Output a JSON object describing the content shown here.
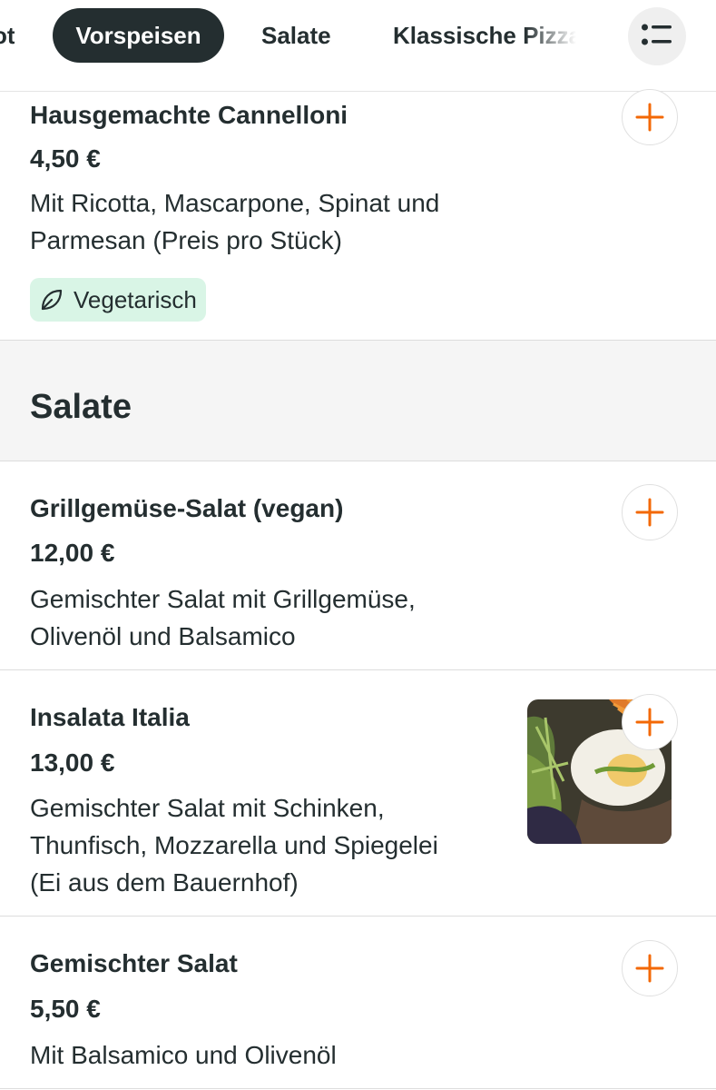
{
  "nav": {
    "tabs": [
      {
        "label": "ot"
      },
      {
        "label": "Vorspeisen"
      },
      {
        "label": "Salate"
      },
      {
        "label": "Klassische Pizza"
      }
    ],
    "menu_icon": "list-icon"
  },
  "items": [
    {
      "name": "Hausgemachte Cannelloni",
      "price": "4,50 €",
      "desc_lines": [
        "Mit Ricotta, Mascarpone, Spinat und",
        "Parmesan (Preis pro Stück)"
      ],
      "badge": "Vegetarisch"
    },
    {
      "name": "Grillgemüse-Salat (vegan)",
      "price": "12,00 €",
      "desc_lines": [
        "Gemischter Salat mit Grillgemüse,",
        "Olivenöl und Balsamico"
      ]
    },
    {
      "name": "Insalata Italia",
      "price": "13,00 €",
      "desc_lines": [
        "Gemischter Salat mit Schinken,",
        "Thunfisch, Mozzarella und Spiegelei",
        "(Ei aus dem Bauernhof)"
      ]
    },
    {
      "name": "Gemischter Salat",
      "price": "5,50 €",
      "desc_lines": [
        "Mit Balsamico und Olivenöl"
      ]
    }
  ],
  "section": {
    "title": "Salate"
  },
  "colors": {
    "accent": "#f36805",
    "text": "#242e30",
    "badge_bg": "#d9f5e6",
    "section_bg": "#f5f5f5"
  }
}
